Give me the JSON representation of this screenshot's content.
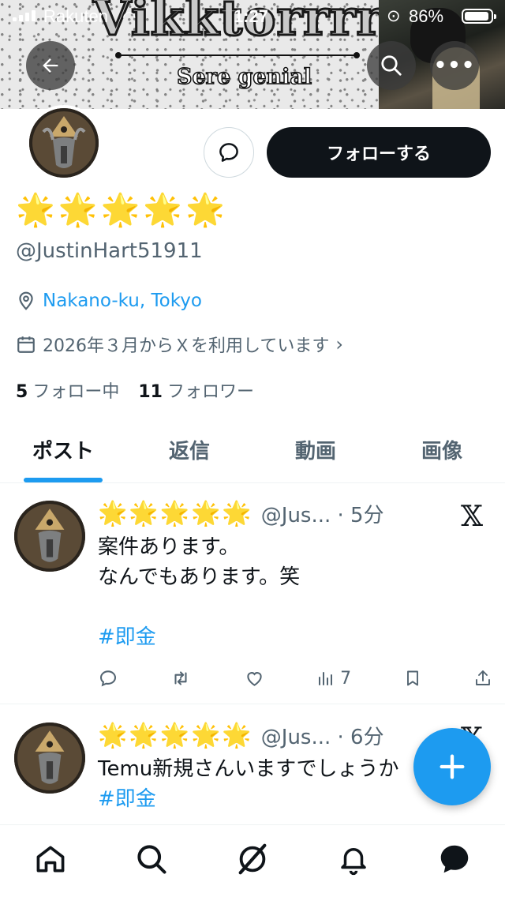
{
  "status_bar": {
    "carrier": "Rakuten",
    "time": "1:27",
    "battery": "86%"
  },
  "banner": {
    "title": "Vikktorrrre",
    "subtitle": "Sere genial"
  },
  "profile": {
    "display_name": "🌟🌟🌟🌟🌟",
    "handle": "@JustinHart51911",
    "location": "Nakano-ku, Tokyo",
    "joined": "2026年３月からＸを利用しています",
    "following_count": "5",
    "following_label": "フォロー中",
    "followers_count": "11",
    "followers_label": "フォロワー",
    "follow_button": "フォローする"
  },
  "tabs": [
    "ポスト",
    "返信",
    "動画",
    "画像"
  ],
  "posts": [
    {
      "display_name": "🌟🌟🌟🌟🌟",
      "handle_meta": "@Jus... · 5分",
      "lines": [
        "案件あります。",
        "なんでもあります。笑",
        "",
        "#即金"
      ],
      "views": "7"
    },
    {
      "display_name": "🌟🌟🌟🌟🌟",
      "handle_meta": "@Jus... · 6分",
      "lines": [
        "Temu新規さんいますでしょうか",
        "#即金"
      ]
    }
  ],
  "colors": {
    "accent": "#1d9bf0",
    "text": "#0f1419",
    "secondary": "#536471"
  }
}
